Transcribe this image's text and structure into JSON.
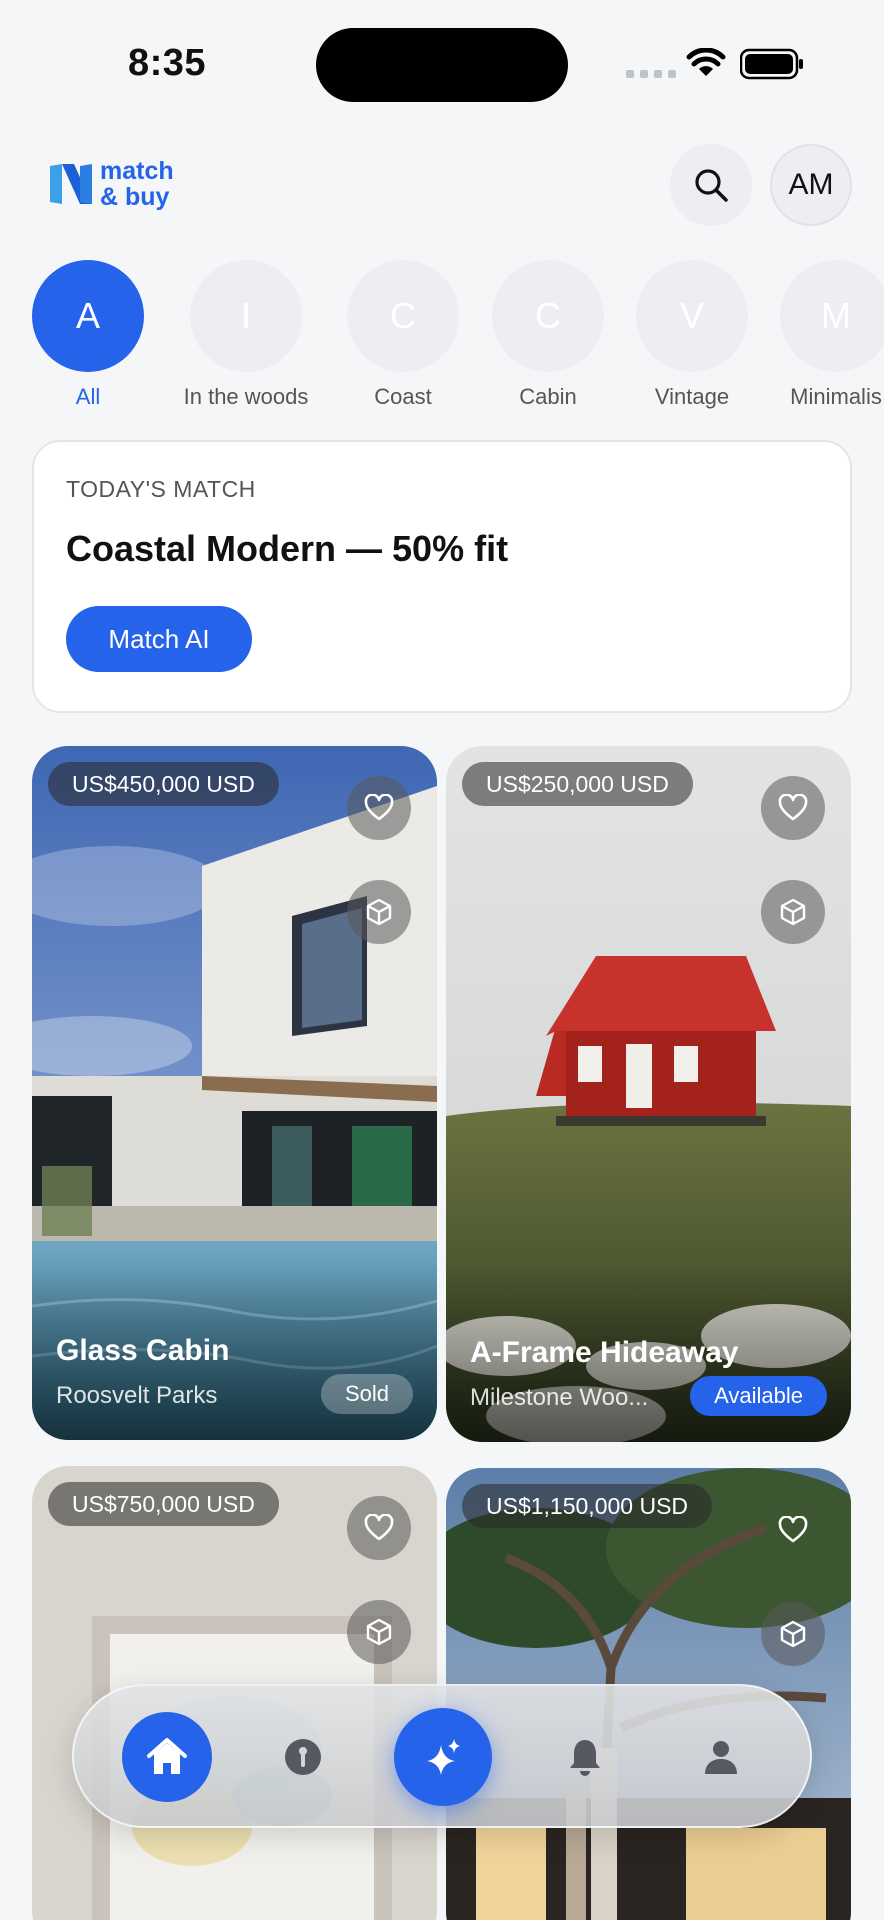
{
  "status_bar": {
    "time": "8:35"
  },
  "header": {
    "logo_line1": "match",
    "logo_line2": "& buy",
    "avatar_initials": "AM"
  },
  "categories": [
    {
      "initial": "A",
      "label": "All",
      "active": true
    },
    {
      "initial": "I",
      "label": "In the woods"
    },
    {
      "initial": "C",
      "label": "Coast"
    },
    {
      "initial": "C",
      "label": "Cabin"
    },
    {
      "initial": "V",
      "label": "Vintage"
    },
    {
      "initial": "M",
      "label": "Minimalis"
    }
  ],
  "match_card": {
    "kicker": "TODAY'S MATCH",
    "title": "Coastal Modern — 50% fit",
    "button": "Match AI"
  },
  "listings": [
    {
      "price": "US$450,000 USD",
      "title": "Glass Cabin",
      "location": "Roosvelt Parks",
      "status": "Sold"
    },
    {
      "price": "US$250,000 USD",
      "title": "A-Frame Hideaway",
      "location": "Milestone Woo...",
      "status": "Available"
    },
    {
      "price": "US$750,000 USD"
    },
    {
      "price": "US$1,150,000 USD"
    }
  ],
  "tabbar": [
    "home-icon",
    "key-icon",
    "sparkles-icon",
    "bell-icon",
    "profile-icon"
  ],
  "colors": {
    "accent": "#2563eb",
    "background": "#f5f6f8"
  }
}
